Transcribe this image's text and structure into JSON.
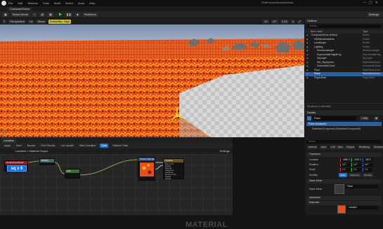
{
  "menu": {
    "items": [
      "File",
      "Edit",
      "Window",
      "Tools",
      "Build",
      "Select",
      "Actor",
      "Help"
    ],
    "project": "ShiftSmoothStarMaterials"
  },
  "tab": {
    "label": "ComposeScene"
  },
  "toolbar": {
    "select_mode": "Select Mode",
    "platforms": "Platforms",
    "settings": "Settings"
  },
  "viewport_bar": {
    "perspective": "Perspective",
    "lit": "Lit",
    "show": "Show",
    "scalability": "Scalability: High",
    "grid": "10",
    "angle": "10°",
    "scale": "0.25",
    "speed": "4"
  },
  "outliner": {
    "title": "Outliner",
    "search_placeholder": "Search...",
    "col_label": "Item Label",
    "col_type": "Type",
    "rows": [
      {
        "label": "ComposeScene (Editor)",
        "type": "World",
        "indent": 0,
        "selected": false
      },
      {
        "label": "HDRIandAmbients",
        "type": "Folder",
        "indent": 1,
        "selected": false
      },
      {
        "label": "Landscape",
        "type": "Folder",
        "indent": 1,
        "selected": false
      },
      {
        "label": "Lighting",
        "type": "Folder",
        "indent": 1,
        "selected": false
      },
      {
        "label": "DirectionalLight",
        "type": "DirectionalLight",
        "indent": 2,
        "selected": false
      },
      {
        "label": "ExponentialHeightFog",
        "type": "ExponentialHeig",
        "indent": 2,
        "selected": false
      },
      {
        "label": "SkyLight",
        "type": "SkyLight",
        "indent": 2,
        "selected": false
      },
      {
        "label": "SM_SkySphere",
        "type": "StaticMeshActor",
        "indent": 2,
        "selected": false
      },
      {
        "label": "VolumetricCloud",
        "type": "VolumetricCloud",
        "indent": 2,
        "selected": false
      },
      {
        "label": "Floor",
        "type": "StaticMeshActor",
        "indent": 1,
        "selected": false
      },
      {
        "label": "Plane",
        "type": "StaticMeshActor",
        "indent": 1,
        "selected": true
      },
      {
        "label": "PlayerStart",
        "type": "PlayerStart",
        "indent": 1,
        "selected": false
      }
    ],
    "footer": "92 actors (1 selected)"
  },
  "details": {
    "title": "Details",
    "actor_name": "Plane",
    "add_label": "+ Add",
    "component_root": "Plane (Instance)",
    "component_child": "StaticMeshComponent (StaticMeshComponent0)",
    "search_placeholder": "Search",
    "filters": [
      "General",
      "Actor",
      "LOD",
      "Misc",
      "Physics",
      "Rendering",
      "Streaming",
      "All"
    ],
    "transform": {
      "section": "Transform",
      "location_label": "Location",
      "location": [
        "-4860.0",
        "-3245.0",
        "-380.0"
      ],
      "rotation_label": "Rotation",
      "rotation": [
        "0.0°",
        "0.0°",
        "0.0°"
      ],
      "scale_label": "Scale",
      "scale": [
        "1.0",
        "1.0",
        "1.0"
      ],
      "mobility_label": "Mobility",
      "mobility_options": [
        "Static",
        "Stationary",
        "Movable"
      ]
    },
    "static_mesh": {
      "section": "Static Mesh",
      "label": "Static Mesh",
      "value": "Plane"
    },
    "advanced": "Advanced",
    "materials": {
      "section": "Materials",
      "slot_value": "Lavaline"
    }
  },
  "material_editor": {
    "tabs": [
      "Lavaline"
    ],
    "toolbar": [
      "Apply",
      "Save",
      "Browse",
      "Find Parents",
      "Live Update",
      "Hide Unrelated",
      "Stats",
      "Platform Stats"
    ],
    "breadcrumb": "Lavaline > Material Graph",
    "settings": "Settings",
    "nodes": {
      "texcoord_title": "TextureCoordinate",
      "texcoord_value": "sq x 6",
      "multiply_title": "Multiply",
      "add_title": "Add",
      "sample_title": "Texture Sample",
      "sample_pins": [
        "UVs",
        "RGB",
        "R",
        "G",
        "B",
        "A",
        "RGBA"
      ],
      "result_title": "Lavaline",
      "result_pins": [
        "Base Color",
        "Metallic",
        "Specular",
        "Roughness",
        "Anisotropy",
        "Emissive Color",
        "Opacity",
        "Normal"
      ]
    },
    "watermark": "MATERIAL"
  },
  "status_bar": {
    "derived_data": "Derived Data",
    "source_control": "Source Control Off"
  },
  "colors": {
    "accent": "#1e6fd1",
    "selected": "#2a5fa0",
    "lava": "#e8501a",
    "play": "#4ec24e"
  }
}
